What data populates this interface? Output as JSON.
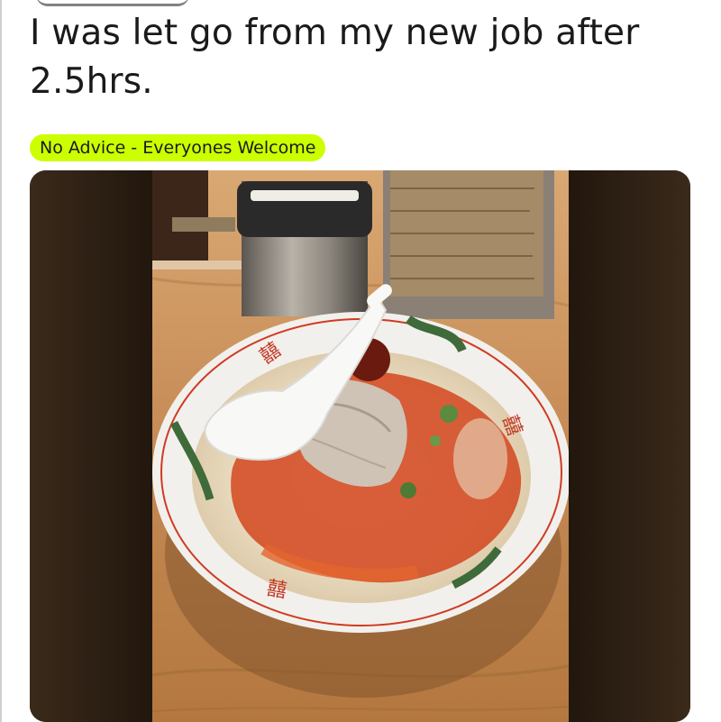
{
  "post": {
    "title": "I was let go from my new job after 2.5hrs.",
    "flair": {
      "label": "No Advice - Everyones Welcome",
      "color": "#ccff00"
    }
  },
  "media": {
    "type": "image",
    "subject": "ramen-bowl-photo"
  }
}
